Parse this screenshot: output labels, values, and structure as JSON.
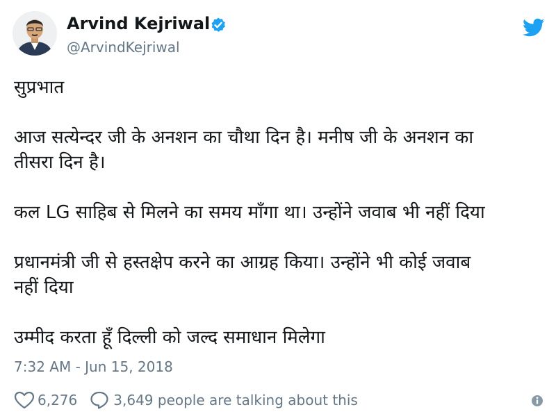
{
  "author": {
    "name": "Arvind Kejriwal",
    "handle": "@ArvindKejriwal",
    "verified": true,
    "avatar_icon": "profile-photo"
  },
  "tweet": {
    "paragraphs": [
      "सुप्रभात",
      "आज सत्येन्दर जी के अनशन का चौथा दिन है। मनीष जी के अनशन का\nतीसरा दिन है।",
      "कल LG साहिब से मिलने का समय माँगा था। उन्होंने जवाब भी नहीं दिया",
      "प्रधानमंत्री जी से हस्तक्षेप करने का आग्रह किया। उन्होंने भी कोई जवाब\nनहीं दिया",
      "उम्मीद करता हूँ दिल्ली को जल्द समाधान मिलेगा"
    ],
    "timestamp": "7:32 AM - Jun 15, 2018"
  },
  "stats": {
    "likes": "6,276",
    "talking": "3,649 people are talking about this"
  },
  "colors": {
    "twitter_blue": "#1da1f2",
    "text": "#14171a",
    "muted": "#657786"
  },
  "icons": [
    "verified-badge-icon",
    "twitter-bird-icon",
    "heart-icon",
    "reply-icon",
    "info-icon"
  ]
}
